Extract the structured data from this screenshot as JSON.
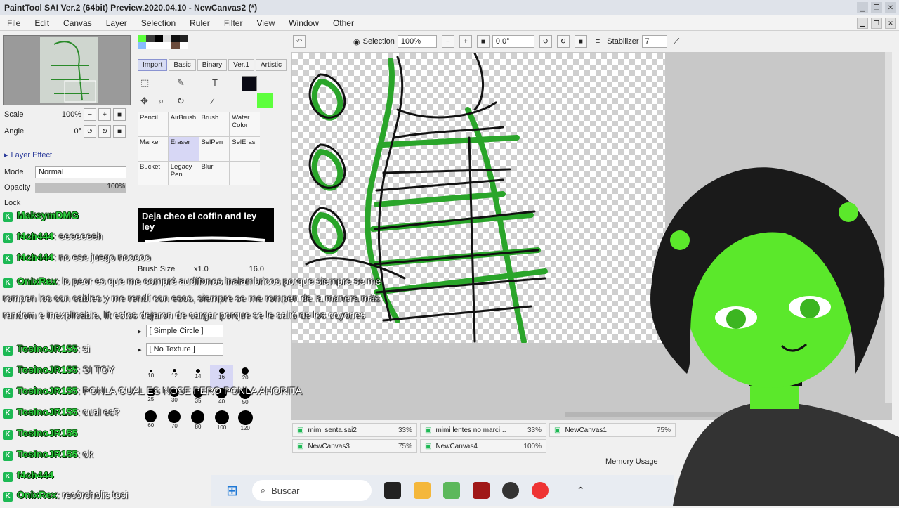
{
  "window": {
    "title": "PaintTool SAI Ver.2 (64bit) Preview.2020.04.10 - NewCanvas2 (*)"
  },
  "menu": [
    "File",
    "Edit",
    "Canvas",
    "Layer",
    "Selection",
    "Ruler",
    "Filter",
    "View",
    "Window",
    "Other"
  ],
  "navigator": {
    "scale_label": "Scale",
    "scale_value": "100%",
    "angle_label": "Angle",
    "angle_value": "0°"
  },
  "layer": {
    "effect_label": "Layer Effect",
    "mode_label": "Mode",
    "mode_value": "Normal",
    "opacity_label": "Opacity",
    "opacity_value": "100%",
    "lock_label": "Lock"
  },
  "tool_tabs": [
    "Import",
    "Basic",
    "Binary",
    "Ver.1",
    "Artistic"
  ],
  "brushes": [
    {
      "label": "Pencil"
    },
    {
      "label": "AirBrush"
    },
    {
      "label": "Brush"
    },
    {
      "label": "Water Color"
    },
    {
      "label": "Marker"
    },
    {
      "label": "Eraser",
      "active": true
    },
    {
      "label": "SelPen"
    },
    {
      "label": "SelEras"
    },
    {
      "label": "Bucket"
    },
    {
      "label": "Legacy Pen"
    },
    {
      "label": "Blur"
    },
    {
      "label": ""
    }
  ],
  "brush_settings": {
    "brush_size_label": "Brush Size",
    "brush_size_mult": "x1.0",
    "brush_size_value": "16.0",
    "shape": "[ Simple Circle ]",
    "texture": "[ No Texture ]",
    "sizes": [
      "10",
      "12",
      "14",
      "16",
      "20",
      "25",
      "30",
      "35",
      "40",
      "50",
      "60",
      "70",
      "80",
      "100",
      "120"
    ]
  },
  "canvas_toolbar": {
    "selection_label": "Selection",
    "zoom": "100%",
    "rotation": "0.0°",
    "stabilizer_label": "Stabilizer",
    "stabilizer_value": "7"
  },
  "documents": [
    {
      "name": "mimi senta.sai2",
      "pct": "33%"
    },
    {
      "name": "mimi lentes no marci...",
      "pct": "33%"
    },
    {
      "name": "NewCanvas1",
      "pct": "75%"
    },
    {
      "name": "NewCanvas3",
      "pct": "75%"
    },
    {
      "name": "NewCanvas4",
      "pct": "100%"
    }
  ],
  "memory_label": "Memory Usage",
  "taskbar": {
    "search_placeholder": "Buscar"
  },
  "popup_text": "Deja cheo el coffin and ley ley",
  "chat": [
    {
      "user": "MaksymDMG",
      "text": ""
    },
    {
      "user": "f4ch444",
      "text": ": eeeeeeeh"
    },
    {
      "user": "f4ch444",
      "text": ": no ese juego nooooo"
    },
    {
      "user": "OnixRex",
      "text": ": lo peor es que me compré audífonos inalambricos porque siempre se me rompen los con cables y me rendí con esos, siempre se me rompen de la manera más random e inexplicable, lit estos dejaron de cargar porque se le salió de los coyones"
    },
    {
      "user": "TosinoJR155",
      "text": ": si"
    },
    {
      "user": "TosinoJR155",
      "text": ": SI TOY"
    },
    {
      "user": "TosinoJR155",
      "text": ": PONLA CUAL ES NOSE PERO PONLA AHORITA"
    },
    {
      "user": "TosinoJR155",
      "text": ": cual es?"
    },
    {
      "user": "TosinoJR155",
      "text": ""
    },
    {
      "user": "TosinoJR155",
      "text": ": ok"
    },
    {
      "user": "f4ch444",
      "text": ""
    },
    {
      "user": "OnixRex",
      "text": ": recórcholis tosi"
    }
  ]
}
